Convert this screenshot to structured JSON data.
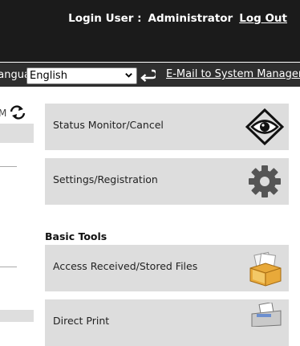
{
  "header": {
    "login_label": "Login User :",
    "login_user": "Administrator",
    "logout_label": "Log Out"
  },
  "toolbar": {
    "language_label": "Language:",
    "language_value": "English",
    "email_link": "E-Mail to System Manager"
  },
  "left_panel": {
    "fragment_text": "M"
  },
  "tiles": [
    {
      "label": "Status Monitor/Cancel",
      "icon": "eye-icon"
    },
    {
      "label": "Settings/Registration",
      "icon": "gear-icon"
    }
  ],
  "basic_tools": {
    "title": "Basic Tools",
    "tiles": [
      {
        "label": "Access Received/Stored Files",
        "icon": "file-box-icon"
      },
      {
        "label": "Direct Print",
        "icon": "printer-icon"
      }
    ]
  },
  "colors": {
    "header_bg": "#1b1b1b",
    "toolbar_bg": "#2e2e2e",
    "tile_bg": "#dddddd"
  }
}
